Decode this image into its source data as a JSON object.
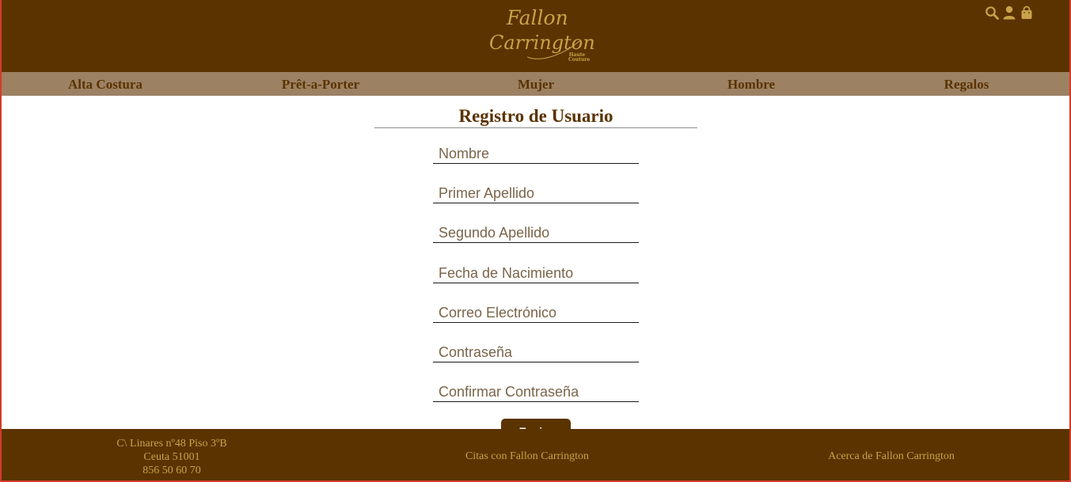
{
  "brand": {
    "line1": "Fallon",
    "line2": "Carrington",
    "line3": "Haute Couture"
  },
  "header_icons": [
    "search-icon",
    "user-icon",
    "shopping-bag-icon"
  ],
  "nav": {
    "items": [
      "Alta Costura",
      "Prêt-a-Porter",
      "Mujer",
      "Hombre",
      "Regalos"
    ]
  },
  "form": {
    "title": "Registro de Usuario",
    "fields": [
      {
        "placeholder": "Nombre",
        "value": ""
      },
      {
        "placeholder": "Primer Apellido",
        "value": ""
      },
      {
        "placeholder": "Segundo Apellido",
        "value": ""
      },
      {
        "placeholder": "Fecha de Nacimiento",
        "value": ""
      },
      {
        "placeholder": "Correo Electrónico",
        "value": ""
      },
      {
        "placeholder": "Contraseña",
        "value": ""
      },
      {
        "placeholder": "Confirmar Contraseña",
        "value": ""
      }
    ],
    "submit_label": "Enviar"
  },
  "footer": {
    "address": [
      "C\\ Linares nº48 Piso 3ºB",
      "Ceuta 51001",
      "856 50 60 70"
    ],
    "citas": "Citas con Fallon Carrington",
    "acerca": "Acerca de Fallon Carrington"
  },
  "colors": {
    "brown": "#5a3300",
    "nav_bg": "#9c8163",
    "gold": "#c9a24a",
    "placeholder": "#7a6448"
  }
}
